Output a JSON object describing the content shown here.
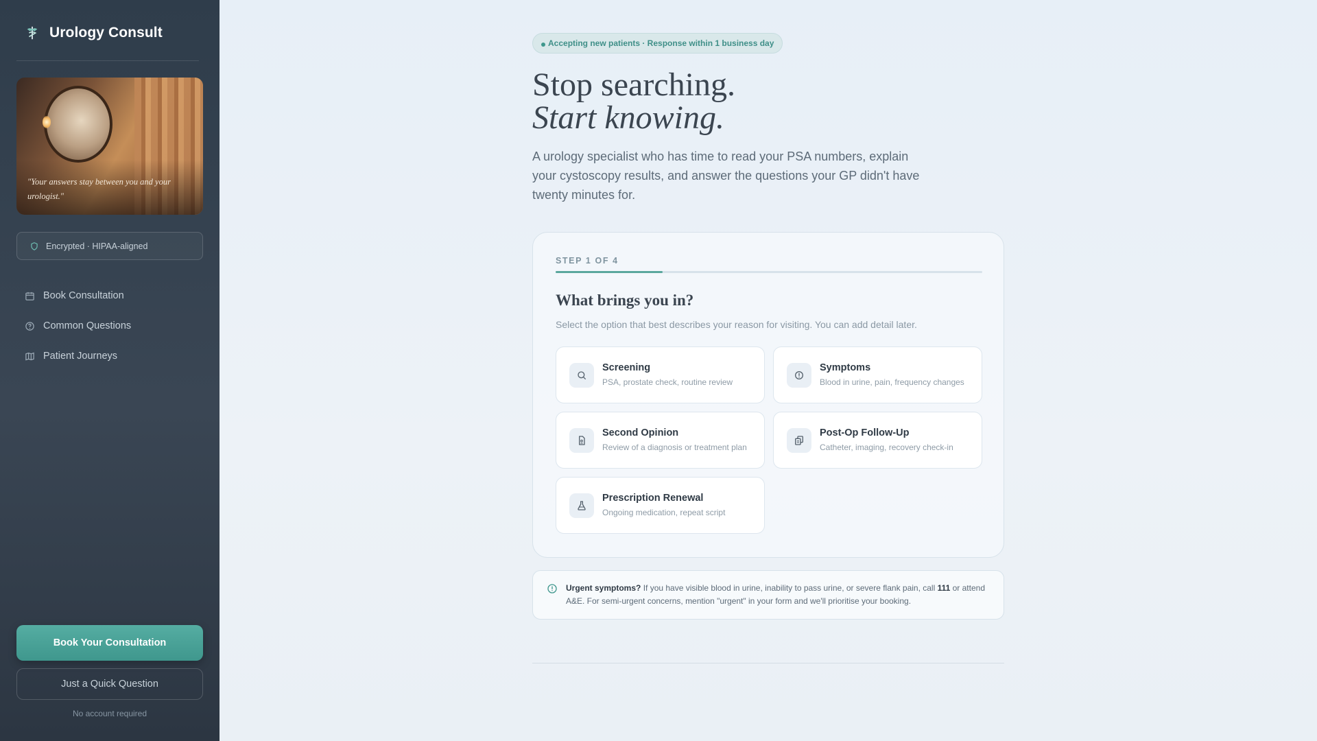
{
  "sidebar": {
    "brand": "Urology Consult",
    "photo_quote": "\"Your answers stay between you and your urologist.\"",
    "secure_label": "Encrypted · HIPAA-aligned",
    "nav": [
      {
        "label": "Book Consultation",
        "icon": "calendar-icon"
      },
      {
        "label": "Common Questions",
        "icon": "help-circle-icon"
      },
      {
        "label": "Patient Journeys",
        "icon": "map-icon"
      }
    ],
    "primary_cta": "Book Your Consultation",
    "secondary_cta": "Just a Quick Question",
    "footnote": "No account required"
  },
  "main": {
    "status_pill": "Accepting new patients · Response within 1 business day",
    "headline_1": "Stop searching.",
    "headline_2": "Start knowing.",
    "lead": "A urology specialist who has time to read your PSA numbers, explain your cystoscopy results, and answer the questions your GP didn't have twenty minutes for.",
    "step": {
      "label": "STEP 1 OF 4",
      "current": 1,
      "total": 4,
      "title": "What brings you in?",
      "subtitle": "Select the option that best describes your reason for visiting. You can add detail later.",
      "options": [
        {
          "title": "Screening",
          "desc": "PSA, prostate check, routine review",
          "icon": "search-icon"
        },
        {
          "title": "Symptoms",
          "desc": "Blood in urine, pain, frequency changes",
          "icon": "alert-circle-icon"
        },
        {
          "title": "Second Opinion",
          "desc": "Review of a diagnosis or treatment plan",
          "icon": "document-icon"
        },
        {
          "title": "Post-Op Follow-Up",
          "desc": "Catheter, imaging, recovery check-in",
          "icon": "clipboard-icon"
        },
        {
          "title": "Prescription Renewal",
          "desc": "Ongoing medication, repeat script",
          "icon": "flask-icon"
        }
      ]
    },
    "alert": {
      "lead": "Urgent symptoms?",
      "text_1": " If you have visible blood in urine, inability to pass urine, or severe flank pain, call ",
      "number": "111",
      "text_2": " or attend A&E. For semi-urgent concerns, mention \"urgent\" in your form and we'll prioritise your booking."
    }
  },
  "colors": {
    "accent": "#3f978d",
    "sidebar_bg": "#2f3d4b",
    "page_bg": "#eaf0f6"
  }
}
